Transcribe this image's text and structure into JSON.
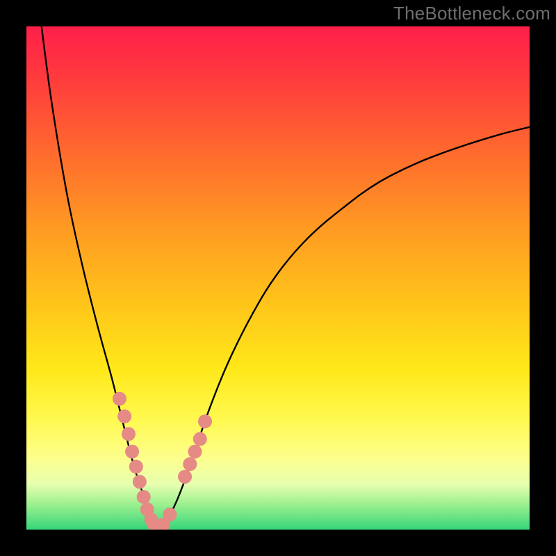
{
  "watermark": "TheBottleneck.com",
  "chart_data": {
    "type": "line",
    "title": "",
    "xlabel": "",
    "ylabel": "",
    "xlim": [
      0,
      100
    ],
    "ylim": [
      0,
      100
    ],
    "series": [
      {
        "name": "bottleneck-curve",
        "x": [
          3,
          5,
          8,
          11,
          14,
          17,
          19,
          21,
          22.5,
          24,
          25,
          26,
          27,
          28,
          30,
          33,
          36,
          40,
          45,
          50,
          56,
          63,
          70,
          78,
          86,
          94,
          100
        ],
        "y": [
          100,
          85,
          67,
          53,
          41,
          30,
          22,
          14,
          9,
          5,
          2,
          0.5,
          0.5,
          2,
          6,
          14,
          23,
          33,
          43,
          51,
          58,
          64,
          69,
          73,
          76,
          78.5,
          80
        ]
      }
    ],
    "markers": [
      {
        "x": 18.5,
        "y": 26
      },
      {
        "x": 19.5,
        "y": 22.5
      },
      {
        "x": 20.3,
        "y": 19
      },
      {
        "x": 21.0,
        "y": 15.5
      },
      {
        "x": 21.8,
        "y": 12.5
      },
      {
        "x": 22.5,
        "y": 9.5
      },
      {
        "x": 23.3,
        "y": 6.5
      },
      {
        "x": 24.0,
        "y": 4.0
      },
      {
        "x": 24.8,
        "y": 2.0
      },
      {
        "x": 25.5,
        "y": 0.8
      },
      {
        "x": 26.3,
        "y": 0.5
      },
      {
        "x": 27.2,
        "y": 1.0
      },
      {
        "x": 28.5,
        "y": 3.0
      },
      {
        "x": 31.5,
        "y": 10.5
      },
      {
        "x": 32.5,
        "y": 13.0
      },
      {
        "x": 33.5,
        "y": 15.5
      },
      {
        "x": 34.5,
        "y": 18.0
      },
      {
        "x": 35.5,
        "y": 21.5
      }
    ],
    "marker_style": {
      "radius_px": 10,
      "fill": "#e58a85"
    }
  },
  "colors": {
    "curve": "#000000",
    "marker": "#e58a85",
    "watermark": "#6f6f6f"
  }
}
